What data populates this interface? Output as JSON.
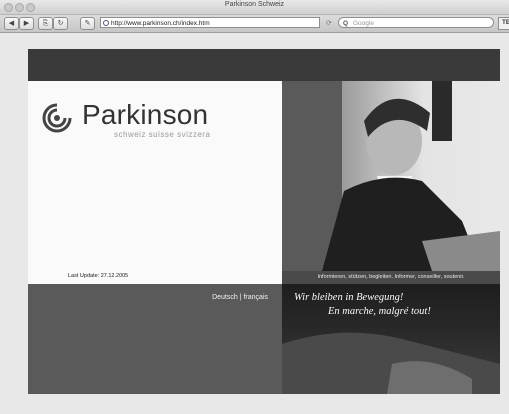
{
  "window": {
    "title": "Parkinson Schweiz"
  },
  "toolbar": {
    "back_icon": "back-arrow-icon",
    "forward_icon": "forward-arrow-icon",
    "url": "http://www.parkinson.ch/index.htm",
    "search_placeholder": "Google",
    "tb_label": "TE"
  },
  "site": {
    "brand_name": "Parkinson",
    "tagline": "schweiz  suisse  svizzera",
    "last_update": "Last Update: 27.12.2005",
    "caption": "Informieren, stützen, begleiten. Informer, conseiller, soutenir.",
    "lang_de": "Deutsch",
    "lang_sep": "|",
    "lang_fr": "français",
    "slogan_de": "Wir bleiben in Bewegung!",
    "slogan_fr": "En marche, malgré tout!"
  },
  "colors": {
    "dark_band": "#3a3a3a",
    "panel_grey": "#5a5a5a",
    "caption_bg": "#4a4a4a"
  }
}
